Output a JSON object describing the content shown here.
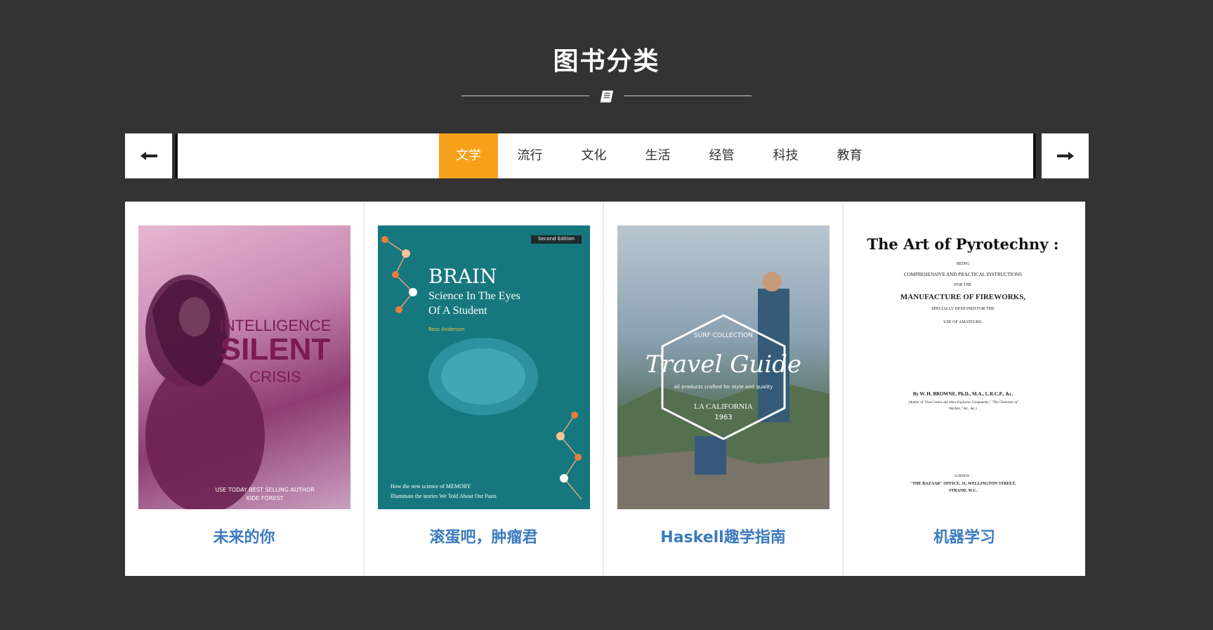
{
  "section": {
    "title": "图书分类",
    "divider_icon": "book-icon"
  },
  "nav": {
    "prev_icon": "arrow-left-icon",
    "next_icon": "arrow-right-icon"
  },
  "tabs": [
    {
      "label": "文学",
      "active": true
    },
    {
      "label": "流行"
    },
    {
      "label": "文化"
    },
    {
      "label": "生活"
    },
    {
      "label": "经管"
    },
    {
      "label": "科技"
    },
    {
      "label": "教育"
    }
  ],
  "colors": {
    "background": "#333333",
    "accent": "#f7a01a",
    "link": "#3b7bbf"
  },
  "books": [
    {
      "title": "未来的你",
      "cover": {
        "line1": "INTELLIGENCE",
        "line2": "SILENT",
        "line3": "CRISIS",
        "footer1": "USE TODAY BEST SELLING AUTHOR",
        "footer2": "KIDE FOREST"
      }
    },
    {
      "title": "滚蛋吧，肿瘤君",
      "cover": {
        "badge": "Second Edition",
        "heading": "BRAIN",
        "sub1": "Science In The Eyes",
        "sub2": "Of A Student",
        "author": "Ross Anderson",
        "foot1": "How the new science of MEMORY",
        "foot2": "Illuminate the stories We Told About Our Pasts"
      }
    },
    {
      "title": "Haskell趣学指南",
      "cover": {
        "small": "SURF COLLECTION",
        "heading": "Travel Guide",
        "tagline": "all products crafted for style and quality",
        "place": "LA CALIFORNIA",
        "year": "1963"
      }
    },
    {
      "title": "机器学习",
      "cover": {
        "heading": "The Art of Pyrotechny :",
        "l1": "BEING",
        "l2": "COMPREHENSIVE AND PRACTICAL INSTRUCTIONS",
        "l3": "FOR THE",
        "l4": "MANUFACTURE OF FIREWORKS,",
        "l5": "SPECIALLY DESIGNED FOR THE",
        "l6": "USE OF AMATEURS.",
        "author": "By W. H. BROWNE, Ph.D., M.A., L.R.C.P., &c.",
        "note1": "(Author of \"Gun Cotton and other Explosive Compounds,\" \"The Chemistry of",
        "note2": "Warfare,\" &c., &c.)",
        "pub1": "LONDON :",
        "pub2": "\"THE BAZAAR\" OFFICE, 31, WELLINGTON STREET,",
        "pub3": "STRAND, W.C."
      }
    }
  ]
}
